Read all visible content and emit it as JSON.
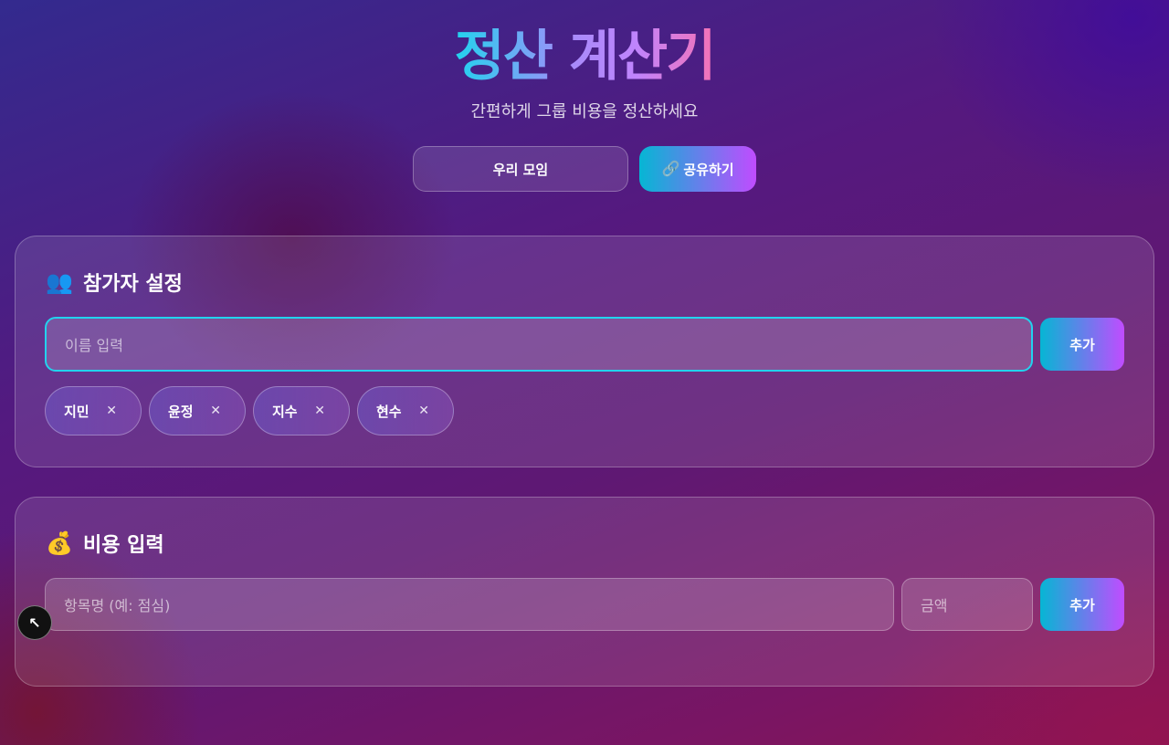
{
  "header": {
    "title": "정산 계산기",
    "subtitle": "간편하게 그룹 비용을 정산하세요"
  },
  "top_controls": {
    "group_name": "우리 모임",
    "share_icon": "🔗",
    "share_label": "공유하기"
  },
  "participants_card": {
    "icon": "👥",
    "title": "참가자 설정",
    "name_placeholder": "이름 입력",
    "add_label": "추가",
    "participants": [
      {
        "name": "지민"
      },
      {
        "name": "윤정"
      },
      {
        "name": "지수"
      },
      {
        "name": "현수"
      }
    ],
    "remove_glyph": "✕"
  },
  "expense_card": {
    "icon": "💰",
    "title": "비용 입력",
    "item_placeholder": "항목명 (예: 점심)",
    "amount_placeholder": "금액",
    "add_label": "추가"
  },
  "cursor_badge": {
    "glyph": "↖"
  },
  "colors": {
    "accent_start": "#06b6d4",
    "accent_end": "#c04cff",
    "focus_border": "#22d3ee"
  }
}
